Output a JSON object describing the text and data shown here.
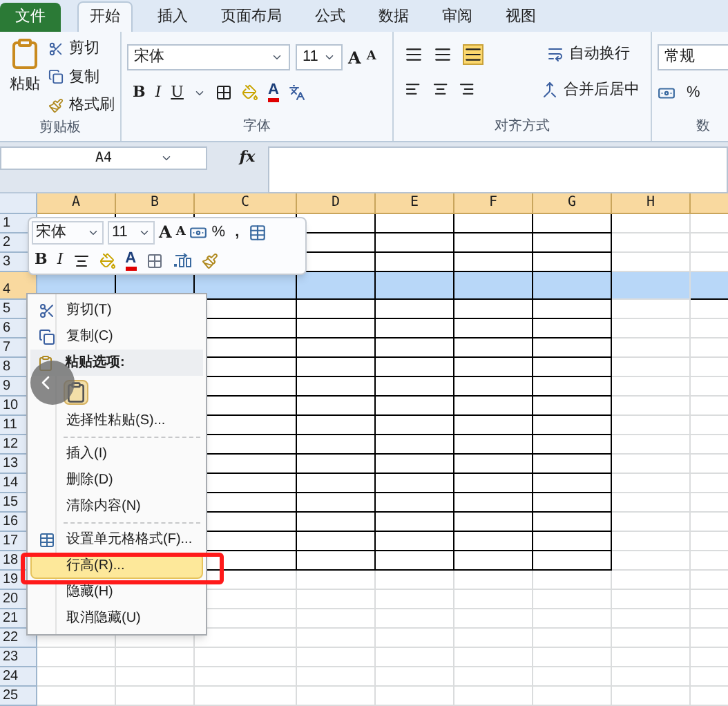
{
  "ribbon_tabs": [
    {
      "label": "文件",
      "kind": "file"
    },
    {
      "label": "开始",
      "kind": "tab",
      "selected": true
    },
    {
      "label": "插入",
      "kind": "tab",
      "selected": false
    },
    {
      "label": "页面布局",
      "kind": "tab",
      "selected": false
    },
    {
      "label": "公式",
      "kind": "tab",
      "selected": false
    },
    {
      "label": "数据",
      "kind": "tab",
      "selected": false
    },
    {
      "label": "审阅",
      "kind": "tab",
      "selected": false
    },
    {
      "label": "视图",
      "kind": "tab",
      "selected": false
    }
  ],
  "clipboard_group": {
    "paste": "粘贴",
    "cut": "剪切",
    "copy": "复制",
    "format_painter": "格式刷",
    "label": "剪贴板"
  },
  "font_group": {
    "font": "宋体",
    "size": "11",
    "grow": "A",
    "shrink": "A",
    "bold": "B",
    "italic": "I",
    "underline": "U",
    "font_color": "A",
    "label": "字体"
  },
  "alignment_group": {
    "wrap_text": "自动换行",
    "merge_center": "合并后居中",
    "label": "对齐方式"
  },
  "number_group": {
    "format": "常规",
    "percent": "%",
    "label": "数"
  },
  "name_box": {
    "value": "A4"
  },
  "formula_bar": {
    "fx": "fx"
  },
  "columns": [
    "A",
    "B",
    "C",
    "D",
    "E",
    "F",
    "G",
    "H"
  ],
  "rows": [
    {
      "label": "1",
      "selected": false
    },
    {
      "label": "2",
      "selected": false
    },
    {
      "label": "3",
      "selected": false
    },
    {
      "label": "4",
      "selected": true
    },
    {
      "label": "5",
      "selected": false
    },
    {
      "label": "6",
      "selected": false
    },
    {
      "label": "7",
      "selected": false
    },
    {
      "label": "8",
      "selected": false
    },
    {
      "label": "9",
      "selected": false
    },
    {
      "label": "10",
      "selected": false
    },
    {
      "label": "11",
      "selected": false
    },
    {
      "label": "12",
      "selected": false
    },
    {
      "label": "13",
      "selected": false
    },
    {
      "label": "14",
      "selected": false
    },
    {
      "label": "15",
      "selected": false
    },
    {
      "label": "16",
      "selected": false
    },
    {
      "label": "17",
      "selected": false
    },
    {
      "label": "18",
      "selected": false
    },
    {
      "label": "19",
      "selected": false
    },
    {
      "label": "20",
      "selected": false
    },
    {
      "label": "21",
      "selected": false
    },
    {
      "label": "22",
      "selected": false
    },
    {
      "label": "23",
      "selected": false
    },
    {
      "label": "24",
      "selected": false
    },
    {
      "label": "25",
      "selected": false
    }
  ],
  "mini_toolbar": {
    "font": "宋体",
    "size": "11",
    "grow": "A",
    "shrink": "A",
    "percent": "%",
    "comma": ",",
    "bold": "B",
    "italic": "I",
    "font_color": "A"
  },
  "context_menu": [
    {
      "kind": "item",
      "label": "剪切(T)",
      "selected": false
    },
    {
      "kind": "item",
      "label": "复制(C)",
      "selected": false
    },
    {
      "kind": "header",
      "label": "粘贴选项:"
    },
    {
      "kind": "paste_icons"
    },
    {
      "kind": "item",
      "label": "选择性粘贴(S)...",
      "selected": false
    },
    {
      "kind": "separator"
    },
    {
      "kind": "item",
      "label": "插入(I)",
      "selected": false
    },
    {
      "kind": "item",
      "label": "删除(D)",
      "selected": false
    },
    {
      "kind": "item",
      "label": "清除内容(N)",
      "selected": false
    },
    {
      "kind": "separator"
    },
    {
      "kind": "item",
      "label": "设置单元格格式(F)...",
      "selected": false
    },
    {
      "kind": "item",
      "label": "行高(R)...",
      "selected": true
    },
    {
      "kind": "item",
      "label": "隐藏(H)",
      "selected": false
    },
    {
      "kind": "item",
      "label": "取消隐藏(U)",
      "selected": false
    }
  ]
}
